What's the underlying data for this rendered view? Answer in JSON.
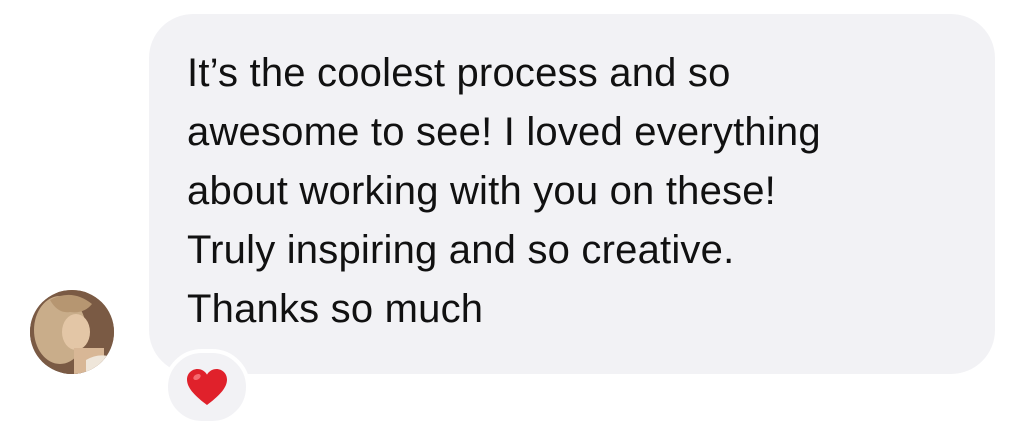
{
  "message": {
    "text": "It’s the coolest process and so\nawesome to see! I loved everything\nabout working with you on these!\nTruly inspiring and so creative.\nThanks so much"
  },
  "reaction": {
    "icon": "red-heart-icon",
    "color": "#e0212b"
  },
  "colors": {
    "bubble_background": "#f2f2f5",
    "text": "#111111"
  }
}
